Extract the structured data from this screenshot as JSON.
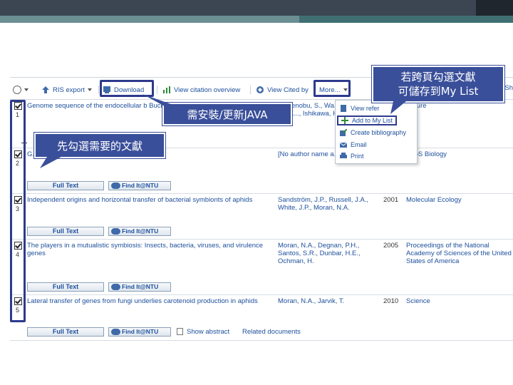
{
  "toolbar": {
    "ris_label": "RIS export",
    "download_label": "Download",
    "citation_label": "View citation overview",
    "cited_label": "View Cited by",
    "more_label": "More..."
  },
  "dropdown": {
    "items": [
      {
        "label": "View refer",
        "icon": "document-icon"
      },
      {
        "label": "Add to My List",
        "icon": "plus-icon"
      },
      {
        "label": "Create bibliography",
        "icon": "pen-icon"
      },
      {
        "label": "Email",
        "icon": "envelope-icon"
      },
      {
        "label": "Print",
        "icon": "printer-icon"
      }
    ]
  },
  "rows": [
    {
      "num": "1",
      "title": "Genome sequence of the endocellular b Buchnera sp. APS",
      "authors": "Shigenobu, S., Wa..., Hattori, M., Saka..., Ishikawa, H.",
      "year": "",
      "source": "Nature"
    },
    {
      "num": "2",
      "title": "G... Acyrthosiphon pisum.",
      "authors": "[No author name a...",
      "year": "",
      "source": "PLoS Biology"
    },
    {
      "num": "3",
      "title": "Independent origins and horizontal transfer of bacterial symbionts of aphids",
      "authors": "Sandström, J.P., Russell, J.A., White, J.P., Moran, N.A.",
      "year": "2001",
      "source": "Molecular Ecology"
    },
    {
      "num": "4",
      "title": "The players in a mutualistic symbiosis: Insects, bacteria, viruses, and virulence genes",
      "authors": "Moran, N.A., Degnan, P.H., Santos, S.R., Dunbar, H.E., Ochman, H.",
      "year": "2005",
      "source": "Proceedings of the National Academy of Sciences of the United States of America"
    },
    {
      "num": "5",
      "title": "Lateral transfer of genes from fungi underlies carotenoid production in aphids",
      "authors": "Moran, N.A., Jarvik, T.",
      "year": "2010",
      "source": "Science"
    }
  ],
  "buttons": {
    "full_text": "Full Text",
    "find_it": "Find It@NTU",
    "show_abstract": "Show abstract",
    "related_documents": "Related documents"
  },
  "callouts": {
    "java": "需安裝/更新JAVA",
    "select": "先勾選需要的文獻",
    "mylist_line1": "若跨頁勾選文獻",
    "mylist_line2": "可儲存到My List"
  },
  "edge_text": "Sh",
  "colors": {
    "link": "#1d4f9c",
    "callout": "#3a4f9a",
    "highlight": "#2d3a8c"
  }
}
